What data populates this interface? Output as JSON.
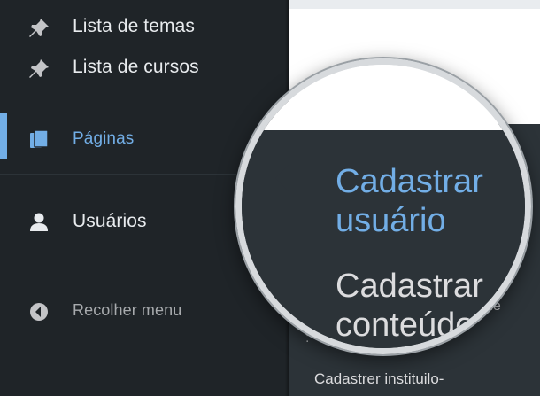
{
  "sidebar": {
    "items": [
      {
        "label": "Lista de temas",
        "icon": "pin-icon"
      },
      {
        "label": "Lista de cursos",
        "icon": "pin-icon"
      },
      {
        "label": "Páginas",
        "icon": "pages-icon",
        "active": true
      },
      {
        "label": "Usuários",
        "icon": "users-icon"
      },
      {
        "label": "Recolher menu",
        "icon": "collapse-icon"
      }
    ]
  },
  "submenu": {
    "items": [
      {
        "label": "Cadastrar usuário",
        "highlighted": true
      },
      {
        "label": "Cadastrar conteúdo"
      },
      {
        "label": "Cadastrer instituilo-"
      }
    ],
    "overflow_fragment": "de"
  },
  "colors": {
    "sidebar_bg": "#1f2428",
    "submenu_bg": "#2c3338",
    "accent": "#72aee6",
    "text": "#e8ebee",
    "muted_text": "#a7aaad"
  }
}
